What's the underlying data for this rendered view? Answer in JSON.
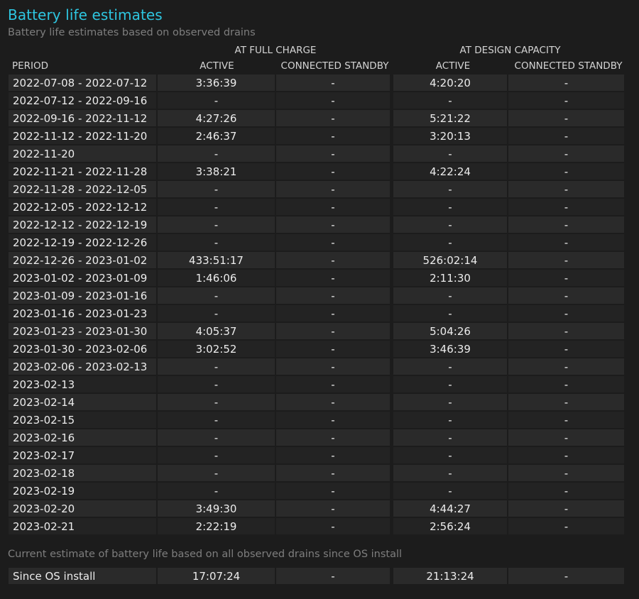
{
  "page": {
    "title": "Battery life estimates",
    "subtitle": "Battery life estimates based on observed drains"
  },
  "header": {
    "group_full": "AT FULL CHARGE",
    "group_design": "AT DESIGN CAPACITY",
    "col_period": "PERIOD",
    "col_full_active": "ACTIVE",
    "col_full_standby": "CONNECTED STANDBY",
    "col_design_active": "ACTIVE",
    "col_design_standby": "CONNECTED STANDBY"
  },
  "rows": [
    {
      "period": "2022-07-08 - 2022-07-12",
      "full_active": "3:36:39",
      "full_standby": "-",
      "design_active": "4:20:20",
      "design_standby": "-"
    },
    {
      "period": "2022-07-12 - 2022-09-16",
      "full_active": "-",
      "full_standby": "-",
      "design_active": "-",
      "design_standby": "-"
    },
    {
      "period": "2022-09-16 - 2022-11-12",
      "full_active": "4:27:26",
      "full_standby": "-",
      "design_active": "5:21:22",
      "design_standby": "-"
    },
    {
      "period": "2022-11-12 - 2022-11-20",
      "full_active": "2:46:37",
      "full_standby": "-",
      "design_active": "3:20:13",
      "design_standby": "-"
    },
    {
      "period": "2022-11-20",
      "full_active": "-",
      "full_standby": "-",
      "design_active": "-",
      "design_standby": "-"
    },
    {
      "period": "2022-11-21 - 2022-11-28",
      "full_active": "3:38:21",
      "full_standby": "-",
      "design_active": "4:22:24",
      "design_standby": "-"
    },
    {
      "period": "2022-11-28 - 2022-12-05",
      "full_active": "-",
      "full_standby": "-",
      "design_active": "-",
      "design_standby": "-"
    },
    {
      "period": "2022-12-05 - 2022-12-12",
      "full_active": "-",
      "full_standby": "-",
      "design_active": "-",
      "design_standby": "-"
    },
    {
      "period": "2022-12-12 - 2022-12-19",
      "full_active": "-",
      "full_standby": "-",
      "design_active": "-",
      "design_standby": "-"
    },
    {
      "period": "2022-12-19 - 2022-12-26",
      "full_active": "-",
      "full_standby": "-",
      "design_active": "-",
      "design_standby": "-"
    },
    {
      "period": "2022-12-26 - 2023-01-02",
      "full_active": "433:51:17",
      "full_standby": "-",
      "design_active": "526:02:14",
      "design_standby": "-"
    },
    {
      "period": "2023-01-02 - 2023-01-09",
      "full_active": "1:46:06",
      "full_standby": "-",
      "design_active": "2:11:30",
      "design_standby": "-"
    },
    {
      "period": "2023-01-09 - 2023-01-16",
      "full_active": "-",
      "full_standby": "-",
      "design_active": "-",
      "design_standby": "-"
    },
    {
      "period": "2023-01-16 - 2023-01-23",
      "full_active": "-",
      "full_standby": "-",
      "design_active": "-",
      "design_standby": "-"
    },
    {
      "period": "2023-01-23 - 2023-01-30",
      "full_active": "4:05:37",
      "full_standby": "-",
      "design_active": "5:04:26",
      "design_standby": "-"
    },
    {
      "period": "2023-01-30 - 2023-02-06",
      "full_active": "3:02:52",
      "full_standby": "-",
      "design_active": "3:46:39",
      "design_standby": "-"
    },
    {
      "period": "2023-02-06 - 2023-02-13",
      "full_active": "-",
      "full_standby": "-",
      "design_active": "-",
      "design_standby": "-"
    },
    {
      "period": "2023-02-13",
      "full_active": "-",
      "full_standby": "-",
      "design_active": "-",
      "design_standby": "-"
    },
    {
      "period": "2023-02-14",
      "full_active": "-",
      "full_standby": "-",
      "design_active": "-",
      "design_standby": "-"
    },
    {
      "period": "2023-02-15",
      "full_active": "-",
      "full_standby": "-",
      "design_active": "-",
      "design_standby": "-"
    },
    {
      "period": "2023-02-16",
      "full_active": "-",
      "full_standby": "-",
      "design_active": "-",
      "design_standby": "-"
    },
    {
      "period": "2023-02-17",
      "full_active": "-",
      "full_standby": "-",
      "design_active": "-",
      "design_standby": "-"
    },
    {
      "period": "2023-02-18",
      "full_active": "-",
      "full_standby": "-",
      "design_active": "-",
      "design_standby": "-"
    },
    {
      "period": "2023-02-19",
      "full_active": "-",
      "full_standby": "-",
      "design_active": "-",
      "design_standby": "-"
    },
    {
      "period": "2023-02-20",
      "full_active": "3:49:30",
      "full_standby": "-",
      "design_active": "4:44:27",
      "design_standby": "-"
    },
    {
      "period": "2023-02-21",
      "full_active": "2:22:19",
      "full_standby": "-",
      "design_active": "2:56:24",
      "design_standby": "-"
    }
  ],
  "footer": {
    "note": "Current estimate of battery life based on all observed drains since OS install",
    "row": {
      "period": "Since OS install",
      "full_active": "17:07:24",
      "full_standby": "-",
      "design_active": "21:13:24",
      "design_standby": "-"
    }
  },
  "colors": {
    "background": "#1c1c1c",
    "title": "#2ec6e0",
    "row_odd": "#2a2a2a",
    "row_even": "#232323",
    "muted_text": "#7e7e7e"
  }
}
